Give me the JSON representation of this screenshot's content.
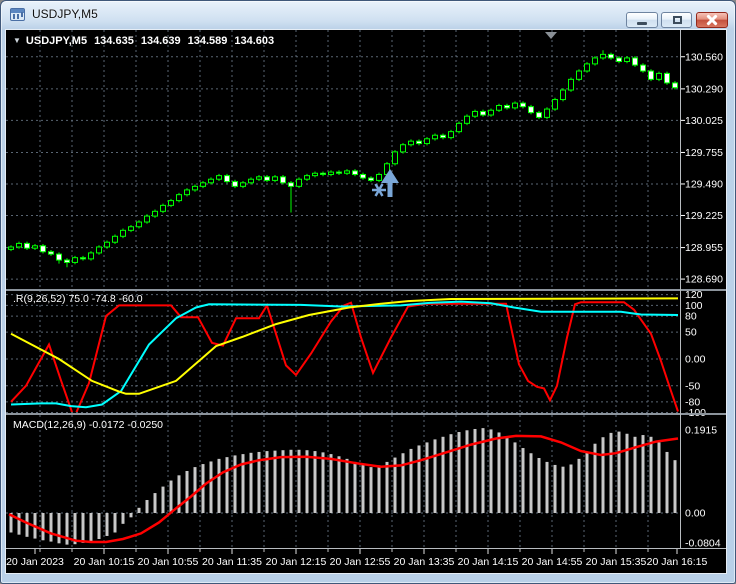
{
  "window": {
    "title": "USDJPY,M5",
    "buttons": [
      {
        "name": "minimize-button",
        "icon": "minimize-icon"
      },
      {
        "name": "restore-button",
        "icon": "restore-icon"
      },
      {
        "name": "close-button",
        "icon": "close-icon"
      }
    ]
  },
  "header": {
    "dropdown": "▼",
    "symbol": "USDJPY,M5",
    "ohlc": [
      "134.635",
      "134.639",
      "134.589",
      "134.603"
    ]
  },
  "pane_labels": {
    "oscillator": ".R(9,26,52) 75.0 -74.8 -60.0",
    "macd": "MACD(12,26,9) -0.0172 -0.0250"
  },
  "colors": {
    "background": "#000000",
    "grid": "#5a6673",
    "bull": "#00FF00",
    "bear_fill": "#FFFFFF",
    "osc_fast": "#FF0000",
    "osc_slow": "#00FFFF",
    "osc_signal": "#FFFF00",
    "macd_hist": "#C8C8C8",
    "macd_signal": "#FF0000",
    "axis_text": "#FFFFFF",
    "separator": "#8c949c",
    "axis_line": "#b8bcc0",
    "object": "#7AA7D8",
    "marker": "#8A9096"
  },
  "chart_data": [
    {
      "type": "candlestick",
      "symbol": "USDJPY",
      "timeframe": "M5",
      "ylim": [
        128.615,
        130.785
      ],
      "grid": true,
      "price_axis_labels": [
        "130.560",
        "130.290",
        "130.025",
        "129.755",
        "129.490",
        "129.225",
        "128.955",
        "128.690"
      ],
      "time_axis_labels": [
        "20 Jan 2023",
        "20 Jan 10:15",
        "20 Jan 10:55",
        "20 Jan 11:35",
        "20 Jan 12:15",
        "20 Jan 12:55",
        "20 Jan 13:35",
        "20 Jan 14:15",
        "20 Jan 14:55",
        "20 Jan 15:35",
        "20 Jan 16:15"
      ],
      "time_label_x": [
        34,
        103,
        167,
        231,
        295,
        359,
        423,
        487,
        551,
        615,
        676
      ],
      "first_open": 128.94,
      "closes": [
        128.96,
        128.99,
        128.95,
        128.97,
        128.92,
        128.9,
        128.85,
        128.83,
        128.87,
        128.86,
        128.91,
        128.96,
        129.0,
        129.05,
        129.1,
        129.13,
        129.17,
        129.22,
        129.26,
        129.31,
        129.35,
        129.4,
        129.44,
        129.47,
        129.5,
        129.53,
        129.56,
        129.51,
        129.47,
        129.5,
        129.53,
        129.55,
        129.52,
        129.55,
        129.5,
        129.47,
        129.53,
        129.56,
        129.58,
        129.57,
        129.59,
        129.58,
        129.6,
        129.57,
        129.54,
        129.52,
        129.57,
        129.66,
        129.76,
        129.82,
        129.85,
        129.83,
        129.87,
        129.9,
        129.88,
        129.93,
        130.0,
        130.06,
        130.1,
        130.07,
        130.11,
        130.15,
        130.13,
        130.17,
        130.14,
        130.09,
        130.05,
        130.12,
        130.2,
        130.28,
        130.37,
        130.44,
        130.5,
        130.55,
        130.58,
        130.55,
        130.52,
        130.55,
        130.49,
        130.44,
        130.37,
        130.42,
        130.34,
        130.3
      ],
      "wick": 0.015,
      "wick_low_overrides": {
        "6": 128.82,
        "7": 128.79,
        "35": 129.25
      },
      "wick_high_overrides": {
        "74": 130.615
      },
      "objects": [
        {
          "name": "buy-arrow-with-star",
          "x": 386,
          "y": 182,
          "color": "#7AA7D8"
        },
        {
          "name": "chart-shift-marker",
          "x": 550,
          "y": 31,
          "color": "#8A9096"
        }
      ]
    },
    {
      "type": "line",
      "name": "oscillator",
      "label": ".R(9,26,52) 75.0 -74.8 -60.0",
      "ylim": [
        -99,
        125
      ],
      "levels": [
        {
          "label": "120",
          "v": 120
        },
        {
          "label": "100",
          "v": 100
        },
        {
          "label": "80",
          "v": 80
        },
        {
          "label": "50",
          "v": 50
        },
        {
          "label": "0.00",
          "v": 0
        },
        {
          "label": "-50",
          "v": -50
        },
        {
          "label": "-80",
          "v": -80
        },
        {
          "label": "-100",
          "v": -100
        }
      ],
      "series": [
        {
          "name": "fast",
          "color": "#FF0000",
          "points": [
            [
              10,
              -80
            ],
            [
              25,
              -50
            ],
            [
              48,
              27
            ],
            [
              60,
              -40
            ],
            [
              73,
              -110
            ],
            [
              88,
              -45
            ],
            [
              105,
              80
            ],
            [
              118,
              100
            ],
            [
              170,
              100
            ],
            [
              180,
              78
            ],
            [
              197,
              78
            ],
            [
              211,
              30
            ],
            [
              222,
              25
            ],
            [
              235,
              76
            ],
            [
              258,
              76
            ],
            [
              266,
              100
            ],
            [
              285,
              -12
            ],
            [
              295,
              -30
            ],
            [
              310,
              10
            ],
            [
              330,
              70
            ],
            [
              343,
              100
            ],
            [
              350,
              105
            ],
            [
              360,
              40
            ],
            [
              372,
              -26
            ],
            [
              390,
              40
            ],
            [
              407,
              98
            ],
            [
              425,
              103
            ],
            [
              505,
              103
            ],
            [
              518,
              -10
            ],
            [
              527,
              -41
            ],
            [
              536,
              -52
            ],
            [
              543,
              -55
            ],
            [
              549,
              -77
            ],
            [
              556,
              -50
            ],
            [
              566,
              40
            ],
            [
              574,
              102
            ],
            [
              580,
              106
            ],
            [
              623,
              106
            ],
            [
              633,
              92
            ],
            [
              650,
              47
            ],
            [
              660,
              -4
            ],
            [
              670,
              -60
            ],
            [
              677,
              -98
            ]
          ]
        },
        {
          "name": "slow",
          "color": "#00FFFF",
          "points": [
            [
              10,
              -85
            ],
            [
              40,
              -83
            ],
            [
              55,
              -83
            ],
            [
              70,
              -88
            ],
            [
              85,
              -90
            ],
            [
              101,
              -85
            ],
            [
              120,
              -60
            ],
            [
              148,
              27
            ],
            [
              175,
              76
            ],
            [
              195,
              96
            ],
            [
              208,
              102
            ],
            [
              300,
              101
            ],
            [
              340,
              98
            ],
            [
              400,
              100
            ],
            [
              430,
              105
            ],
            [
              460,
              107
            ],
            [
              490,
              104
            ],
            [
              513,
              96
            ],
            [
              540,
              88
            ],
            [
              620,
              88
            ],
            [
              640,
              83
            ],
            [
              677,
              82
            ]
          ]
        },
        {
          "name": "signal",
          "color": "#FFFF00",
          "points": [
            [
              10,
              47
            ],
            [
              58,
              0
            ],
            [
              91,
              -41
            ],
            [
              118,
              -61
            ],
            [
              125,
              -65
            ],
            [
              138,
              -65
            ],
            [
              175,
              -41
            ],
            [
              215,
              24
            ],
            [
              241,
              41
            ],
            [
              275,
              65
            ],
            [
              308,
              82
            ],
            [
              348,
              96
            ],
            [
              380,
              103
            ],
            [
              407,
              108
            ],
            [
              450,
              112
            ],
            [
              677,
              113
            ]
          ]
        }
      ]
    },
    {
      "type": "macd",
      "label": "MACD(12,26,9) -0.0172 -0.0250",
      "ylim": [
        -0.0785,
        0.224
      ],
      "axis_labels": [
        {
          "label": "0.1915",
          "v": 0.1915
        },
        {
          "label": "0.00",
          "v": 0
        },
        {
          "label": "-0.0804",
          "v": -0.0804
        }
      ],
      "histogram": [
        -0.045,
        -0.05,
        -0.055,
        -0.059,
        -0.063,
        -0.066,
        -0.07,
        -0.073,
        -0.072,
        -0.069,
        -0.065,
        -0.06,
        -0.053,
        -0.045,
        -0.025,
        -0.01,
        0.012,
        0.03,
        0.046,
        0.061,
        0.075,
        0.087,
        0.097,
        0.106,
        0.113,
        0.119,
        0.125,
        0.129,
        0.133,
        0.136,
        0.139,
        0.141,
        0.143,
        0.144,
        0.145,
        0.146,
        0.146,
        0.145,
        0.143,
        0.14,
        0.136,
        0.131,
        0.125,
        0.118,
        0.112,
        0.106,
        0.11,
        0.118,
        0.128,
        0.138,
        0.148,
        0.156,
        0.163,
        0.17,
        0.176,
        0.182,
        0.187,
        0.191,
        0.194,
        0.196,
        0.193,
        0.186,
        0.176,
        0.163,
        0.15,
        0.138,
        0.127,
        0.118,
        0.111,
        0.107,
        0.112,
        0.125,
        0.142,
        0.16,
        0.175,
        0.185,
        0.188,
        0.183,
        0.176,
        0.18,
        0.176,
        0.163,
        0.141,
        0.122
      ],
      "signal_points": [
        [
          8,
          -0.003
        ],
        [
          25,
          -0.022
        ],
        [
          50,
          -0.047
        ],
        [
          75,
          -0.064
        ],
        [
          90,
          -0.067
        ],
        [
          105,
          -0.067
        ],
        [
          122,
          -0.06
        ],
        [
          140,
          -0.047
        ],
        [
          158,
          -0.022
        ],
        [
          172,
          0.005
        ],
        [
          190,
          0.038
        ],
        [
          205,
          0.068
        ],
        [
          222,
          0.094
        ],
        [
          240,
          0.112
        ],
        [
          258,
          0.122
        ],
        [
          280,
          0.129
        ],
        [
          305,
          0.13
        ],
        [
          330,
          0.125
        ],
        [
          355,
          0.115
        ],
        [
          380,
          0.107
        ],
        [
          400,
          0.11
        ],
        [
          420,
          0.122
        ],
        [
          445,
          0.14
        ],
        [
          470,
          0.158
        ],
        [
          495,
          0.172
        ],
        [
          515,
          0.178
        ],
        [
          540,
          0.177
        ],
        [
          560,
          0.163
        ],
        [
          580,
          0.143
        ],
        [
          600,
          0.134
        ],
        [
          615,
          0.138
        ],
        [
          635,
          0.152
        ],
        [
          655,
          0.165
        ],
        [
          677,
          0.172
        ]
      ]
    }
  ]
}
